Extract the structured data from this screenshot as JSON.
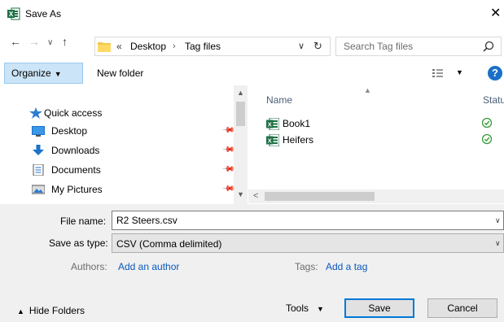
{
  "window": {
    "title": "Save As",
    "app_icon": "excel-icon",
    "close_icon": "close-icon",
    "close_glyph": "✕"
  },
  "navigation": {
    "back_glyph": "←",
    "forward_glyph": "→",
    "recent_glyph": "∨",
    "up_glyph": "↑",
    "breadcrumb": {
      "overflow": "«",
      "items": [
        "Desktop",
        "Tag files"
      ],
      "separator": "›"
    },
    "dropdown_glyph": "∨",
    "refresh_glyph": "↻"
  },
  "search": {
    "placeholder": "Search Tag files",
    "value": ""
  },
  "toolbar": {
    "organize_label": "Organize",
    "caret": "▼",
    "new_folder_label": "New folder",
    "help_label": "?"
  },
  "sidebar": {
    "items": [
      {
        "label": "Quick access",
        "icon": "star-icon",
        "pinned": false
      },
      {
        "label": "Desktop",
        "icon": "desktop-icon",
        "pinned": true
      },
      {
        "label": "Downloads",
        "icon": "download-icon",
        "pinned": true
      },
      {
        "label": "Documents",
        "icon": "documents-icon",
        "pinned": true
      },
      {
        "label": "My Pictures",
        "icon": "pictures-icon",
        "pinned": true
      }
    ],
    "pin_glyph": "📌"
  },
  "file_list": {
    "columns": {
      "name": "Name",
      "status": "Statu"
    },
    "files": [
      {
        "name": "Book1",
        "icon": "excel-file-icon",
        "status_icon": "sync-ok-icon"
      },
      {
        "name": "Heifers",
        "icon": "excel-file-icon",
        "status_icon": "sync-ok-icon"
      }
    ]
  },
  "save_form": {
    "file_name_label": "File name:",
    "file_name_value": "R2 Steers.csv",
    "save_as_type_label": "Save as type:",
    "save_as_type_value": "CSV (Comma delimited)",
    "authors_label": "Authors:",
    "authors_link": "Add an author",
    "tags_label": "Tags:",
    "tags_link": "Add a tag"
  },
  "footer": {
    "hide_folders_label": "Hide Folders",
    "tools_label": "Tools",
    "save_label": "Save",
    "cancel_label": "Cancel"
  },
  "colors": {
    "accent": "#0078d7",
    "excel_green": "#1e7145",
    "link": "#0a58bd",
    "organize_bg": "#cce4f7",
    "folder_yellow": "#f2c94c"
  }
}
